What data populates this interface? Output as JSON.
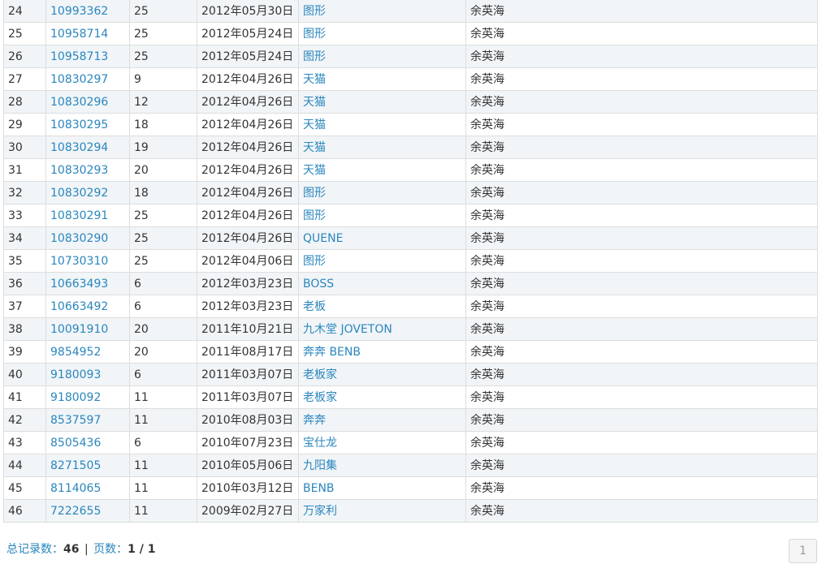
{
  "table": {
    "rows": [
      {
        "no": "24",
        "reg": "10993362",
        "cls": "25",
        "date": "2012年05月30日",
        "name": "图形",
        "owner": "余英海"
      },
      {
        "no": "25",
        "reg": "10958714",
        "cls": "25",
        "date": "2012年05月24日",
        "name": "图形",
        "owner": "余英海"
      },
      {
        "no": "26",
        "reg": "10958713",
        "cls": "25",
        "date": "2012年05月24日",
        "name": "图形",
        "owner": "余英海"
      },
      {
        "no": "27",
        "reg": "10830297",
        "cls": "9",
        "date": "2012年04月26日",
        "name": "天猫",
        "owner": "余英海"
      },
      {
        "no": "28",
        "reg": "10830296",
        "cls": "12",
        "date": "2012年04月26日",
        "name": "天猫",
        "owner": "余英海"
      },
      {
        "no": "29",
        "reg": "10830295",
        "cls": "18",
        "date": "2012年04月26日",
        "name": "天猫",
        "owner": "余英海"
      },
      {
        "no": "30",
        "reg": "10830294",
        "cls": "19",
        "date": "2012年04月26日",
        "name": "天猫",
        "owner": "余英海"
      },
      {
        "no": "31",
        "reg": "10830293",
        "cls": "20",
        "date": "2012年04月26日",
        "name": "天猫",
        "owner": "余英海"
      },
      {
        "no": "32",
        "reg": "10830292",
        "cls": "18",
        "date": "2012年04月26日",
        "name": "图形",
        "owner": "余英海"
      },
      {
        "no": "33",
        "reg": "10830291",
        "cls": "25",
        "date": "2012年04月26日",
        "name": "图形",
        "owner": "余英海"
      },
      {
        "no": "34",
        "reg": "10830290",
        "cls": "25",
        "date": "2012年04月26日",
        "name": "QUENE",
        "owner": "余英海"
      },
      {
        "no": "35",
        "reg": "10730310",
        "cls": "25",
        "date": "2012年04月06日",
        "name": "图形",
        "owner": "余英海"
      },
      {
        "no": "36",
        "reg": "10663493",
        "cls": "6",
        "date": "2012年03月23日",
        "name": "BOSS",
        "owner": "余英海"
      },
      {
        "no": "37",
        "reg": "10663492",
        "cls": "6",
        "date": "2012年03月23日",
        "name": "老板",
        "owner": "余英海"
      },
      {
        "no": "38",
        "reg": "10091910",
        "cls": "20",
        "date": "2011年10月21日",
        "name": "九木堂 JOVETON",
        "owner": "余英海"
      },
      {
        "no": "39",
        "reg": "9854952",
        "cls": "20",
        "date": "2011年08月17日",
        "name": "奔奔 BENB",
        "owner": "余英海"
      },
      {
        "no": "40",
        "reg": "9180093",
        "cls": "6",
        "date": "2011年03月07日",
        "name": "老板家",
        "owner": "余英海"
      },
      {
        "no": "41",
        "reg": "9180092",
        "cls": "11",
        "date": "2011年03月07日",
        "name": "老板家",
        "owner": "余英海"
      },
      {
        "no": "42",
        "reg": "8537597",
        "cls": "11",
        "date": "2010年08月03日",
        "name": "奔奔",
        "owner": "余英海"
      },
      {
        "no": "43",
        "reg": "8505436",
        "cls": "6",
        "date": "2010年07月23日",
        "name": "宝仕龙",
        "owner": "余英海"
      },
      {
        "no": "44",
        "reg": "8271505",
        "cls": "11",
        "date": "2010年05月06日",
        "name": "九阳集",
        "owner": "余英海"
      },
      {
        "no": "45",
        "reg": "8114065",
        "cls": "11",
        "date": "2010年03月12日",
        "name": "BENB",
        "owner": "余英海"
      },
      {
        "no": "46",
        "reg": "7222655",
        "cls": "11",
        "date": "2009年02月27日",
        "name": "万家利",
        "owner": "余英海"
      }
    ]
  },
  "footer": {
    "total_label": "总记录数：",
    "total_value": "46",
    "separator": "|",
    "pages_label": "页数：",
    "pages_value": "1 / 1"
  },
  "pager": {
    "current_page": "1"
  },
  "colors": {
    "link": "#2a86bd",
    "row_alt": "#f1f5f8",
    "border": "#dddddd"
  }
}
